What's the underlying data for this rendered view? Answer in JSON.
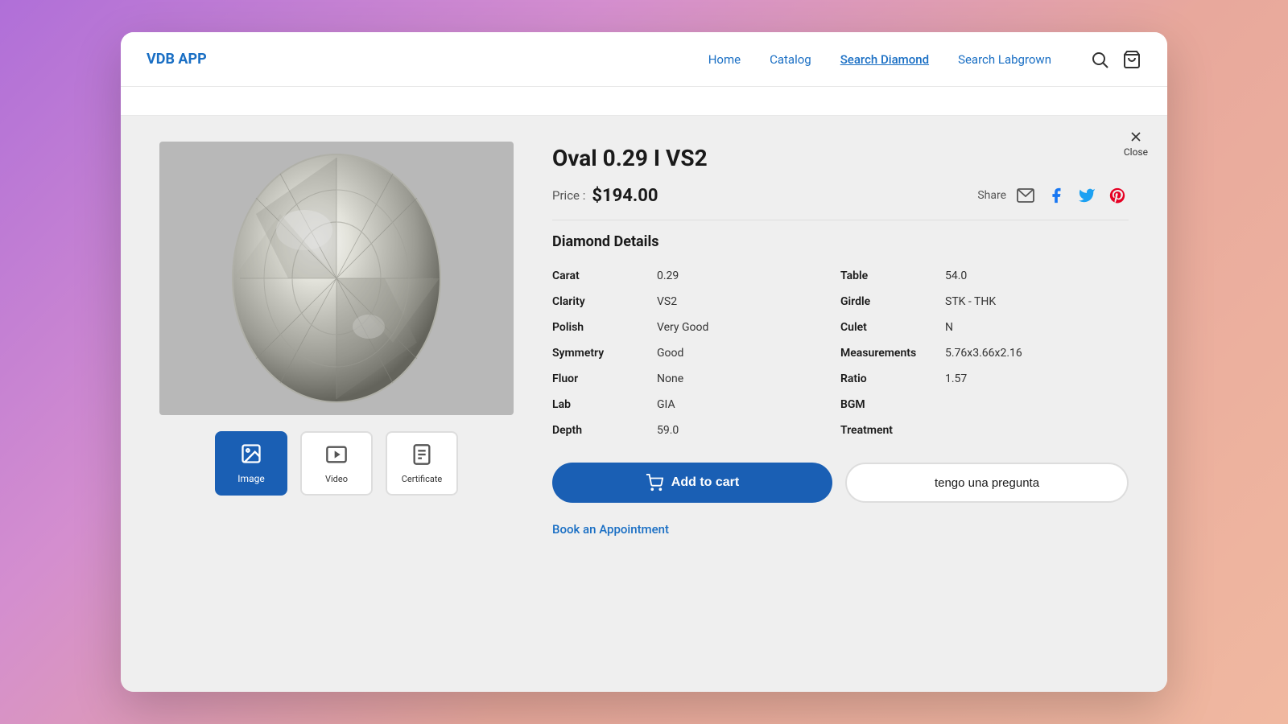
{
  "app": {
    "logo": "VDB APP"
  },
  "nav": {
    "items": [
      {
        "label": "Home",
        "active": false
      },
      {
        "label": "Catalog",
        "active": false
      },
      {
        "label": "Search Diamond",
        "active": true
      },
      {
        "label": "Search Labgrown",
        "active": false
      }
    ]
  },
  "close": {
    "label": "Close"
  },
  "diamond": {
    "title": "Oval 0.29 I VS2",
    "price_label": "Price :",
    "price": "$194.00",
    "share_label": "Share",
    "details_title": "Diamond Details",
    "details_left": [
      {
        "key": "Carat",
        "value": "0.29"
      },
      {
        "key": "Clarity",
        "value": "VS2"
      },
      {
        "key": "Polish",
        "value": "Very Good"
      },
      {
        "key": "Symmetry",
        "value": "Good"
      },
      {
        "key": "Fluor",
        "value": "None"
      },
      {
        "key": "Lab",
        "value": "GIA"
      },
      {
        "key": "Depth",
        "value": "59.0"
      }
    ],
    "details_right": [
      {
        "key": "Table",
        "value": "54.0"
      },
      {
        "key": "Girdle",
        "value": "STK - THK"
      },
      {
        "key": "Culet",
        "value": "N"
      },
      {
        "key": "Measurements",
        "value": "5.76x3.66x2.16"
      },
      {
        "key": "Ratio",
        "value": "1.57"
      },
      {
        "key": "BGM",
        "value": ""
      },
      {
        "key": "Treatment",
        "value": ""
      }
    ]
  },
  "thumbnails": [
    {
      "label": "Image",
      "active": true,
      "icon": "🖼"
    },
    {
      "label": "Video",
      "active": false,
      "icon": "▶"
    },
    {
      "label": "Certificate",
      "active": false,
      "icon": "📋"
    }
  ],
  "buttons": {
    "add_to_cart": "Add to cart",
    "ask": "tengo una pregunta",
    "appointment": "Book an Appointment"
  }
}
